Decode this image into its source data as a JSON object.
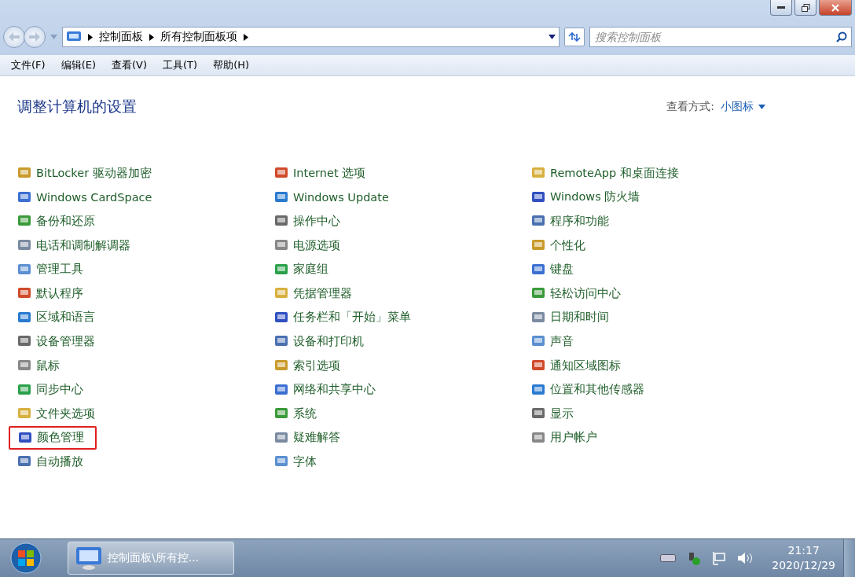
{
  "address_bar": {
    "crumbs": [
      "控制面板",
      "所有控制面板项"
    ],
    "search_placeholder": "搜索控制面板"
  },
  "menu": [
    "文件(F)",
    "编辑(E)",
    "查看(V)",
    "工具(T)",
    "帮助(H)"
  ],
  "header": {
    "title": "调整计算机的设置",
    "view_label": "查看方式:",
    "view_value": "小图标"
  },
  "columns": [
    [
      {
        "label": "BitLocker 驱动器加密",
        "highlighted": false
      },
      {
        "label": "Windows CardSpace",
        "highlighted": false
      },
      {
        "label": "备份和还原",
        "highlighted": false
      },
      {
        "label": "电话和调制解调器",
        "highlighted": false
      },
      {
        "label": "管理工具",
        "highlighted": false
      },
      {
        "label": "默认程序",
        "highlighted": false
      },
      {
        "label": "区域和语言",
        "highlighted": false
      },
      {
        "label": "设备管理器",
        "highlighted": false
      },
      {
        "label": "鼠标",
        "highlighted": false
      },
      {
        "label": "同步中心",
        "highlighted": false
      },
      {
        "label": "文件夹选项",
        "highlighted": false
      },
      {
        "label": "颜色管理",
        "highlighted": true
      },
      {
        "label": "自动播放",
        "highlighted": false
      }
    ],
    [
      {
        "label": "Internet 选项",
        "highlighted": false
      },
      {
        "label": "Windows Update",
        "highlighted": false
      },
      {
        "label": "操作中心",
        "highlighted": false
      },
      {
        "label": "电源选项",
        "highlighted": false
      },
      {
        "label": "家庭组",
        "highlighted": false
      },
      {
        "label": "凭据管理器",
        "highlighted": false
      },
      {
        "label": "任务栏和「开始」菜单",
        "highlighted": false
      },
      {
        "label": "设备和打印机",
        "highlighted": false
      },
      {
        "label": "索引选项",
        "highlighted": false
      },
      {
        "label": "网络和共享中心",
        "highlighted": false
      },
      {
        "label": "系统",
        "highlighted": false
      },
      {
        "label": "疑难解答",
        "highlighted": false
      },
      {
        "label": "字体",
        "highlighted": false
      }
    ],
    [
      {
        "label": "RemoteApp 和桌面连接",
        "highlighted": false
      },
      {
        "label": "Windows 防火墙",
        "highlighted": false
      },
      {
        "label": "程序和功能",
        "highlighted": false
      },
      {
        "label": "个性化",
        "highlighted": false
      },
      {
        "label": "键盘",
        "highlighted": false
      },
      {
        "label": "轻松访问中心",
        "highlighted": false
      },
      {
        "label": "日期和时间",
        "highlighted": false
      },
      {
        "label": "声音",
        "highlighted": false
      },
      {
        "label": "通知区域图标",
        "highlighted": false
      },
      {
        "label": "位置和其他传感器",
        "highlighted": false
      },
      {
        "label": "显示",
        "highlighted": false
      },
      {
        "label": "用户帐户",
        "highlighted": false
      }
    ]
  ],
  "taskbar": {
    "window_button": "控制面板\\所有控...",
    "time": "21:17",
    "date": "2020/12/29"
  }
}
